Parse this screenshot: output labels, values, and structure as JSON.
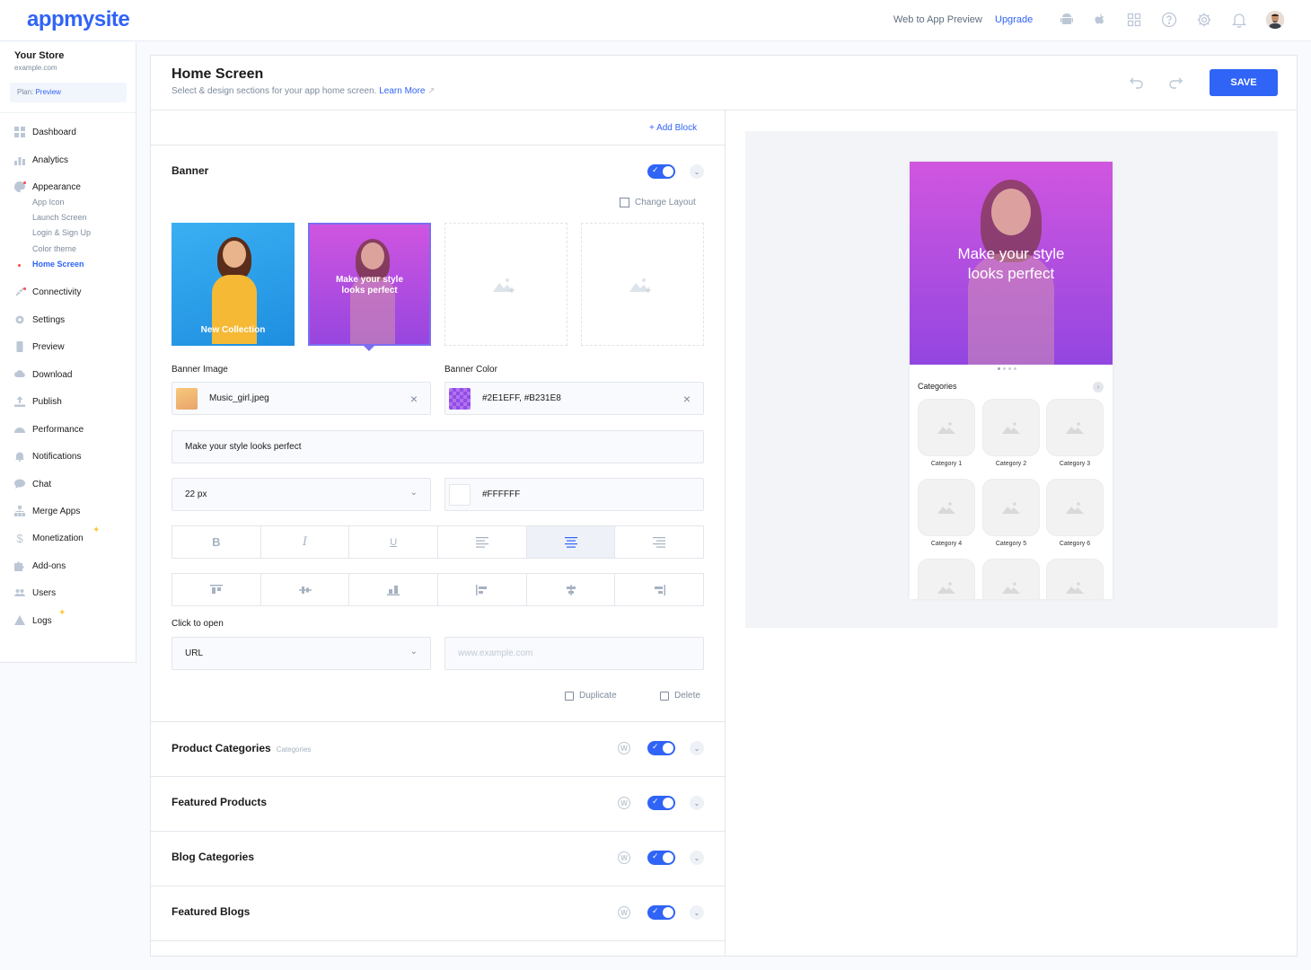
{
  "header": {
    "logo": "appmysite",
    "preview_link": "Web to App Preview",
    "upgrade_link": "Upgrade",
    "icons": [
      "android-icon",
      "apple-icon",
      "grid-icon",
      "help-icon",
      "settings-icon",
      "bell-icon",
      "avatar"
    ]
  },
  "sidebar": {
    "store_name": "Your Store",
    "store_url": "example.com",
    "plan_label": "Plan:",
    "plan_value": "Preview",
    "items": [
      {
        "label": "Dashboard",
        "icon": "dashboard-icon"
      },
      {
        "label": "Analytics",
        "icon": "analytics-icon"
      },
      {
        "label": "Appearance",
        "icon": "palette-icon"
      },
      {
        "label": "Connectivity",
        "icon": "connectivity-icon"
      },
      {
        "label": "Settings",
        "icon": "gear-icon"
      },
      {
        "label": "Preview",
        "icon": "phone-icon"
      },
      {
        "label": "Download",
        "icon": "cloud-download-icon"
      },
      {
        "label": "Publish",
        "icon": "upload-icon"
      },
      {
        "label": "Performance",
        "icon": "speedometer-icon"
      },
      {
        "label": "Notifications",
        "icon": "bell-icon"
      },
      {
        "label": "Chat",
        "icon": "chat-icon"
      },
      {
        "label": "Merge Apps",
        "icon": "merge-icon"
      },
      {
        "label": "Monetization",
        "icon": "dollar-icon"
      },
      {
        "label": "Add-ons",
        "icon": "puzzle-icon"
      },
      {
        "label": "Users",
        "icon": "users-icon"
      },
      {
        "label": "Logs",
        "icon": "warning-icon"
      }
    ],
    "appearance_sub": [
      "App Icon",
      "Launch Screen",
      "Login & Sign Up",
      "Color theme",
      "Home Screen"
    ],
    "active_sub": "Home Screen"
  },
  "page": {
    "title": "Home Screen",
    "subtitle": "Select & design sections for your app home screen.",
    "learn_more": "Learn More",
    "save_label": "SAVE",
    "add_block": "+ Add Block"
  },
  "banner": {
    "title": "Banner",
    "change_layout": "Change Layout",
    "thumb1_caption": "New Collection",
    "thumb2_caption_1": "Make your style",
    "thumb2_caption_2": "looks perfect",
    "banner_image_label": "Banner Image",
    "banner_image_value": "Music_girl.jpeg",
    "banner_color_label": "Banner Color",
    "banner_color_value": "#2E1EFF, #B231E8",
    "text_value": "Make your style looks perfect",
    "font_size": "22 px",
    "text_color": "#FFFFFF",
    "format_buttons": [
      "B",
      "I",
      "U",
      "≡",
      "≡",
      "≡"
    ],
    "click_to_open_label": "Click to open",
    "click_to_open_value": "URL",
    "url_placeholder": "www.example.com",
    "duplicate": "Duplicate",
    "delete": "Delete",
    "colors": {
      "gradient_start": "#2E1EFF",
      "gradient_end": "#B231E8",
      "accent": "#3064F6"
    }
  },
  "blocks": [
    {
      "title": "Product Categories",
      "tag": "Categories"
    },
    {
      "title": "Featured Products",
      "tag": ""
    },
    {
      "title": "Blog Categories",
      "tag": ""
    },
    {
      "title": "Featured Blogs",
      "tag": ""
    }
  ],
  "phone_preview": {
    "banner_line1": "Make your style",
    "banner_line2": "looks perfect",
    "categories_title": "Categories",
    "categories": [
      "Category 1",
      "Category 2",
      "Category 3",
      "Category 4",
      "Category 5",
      "Category 6"
    ]
  }
}
